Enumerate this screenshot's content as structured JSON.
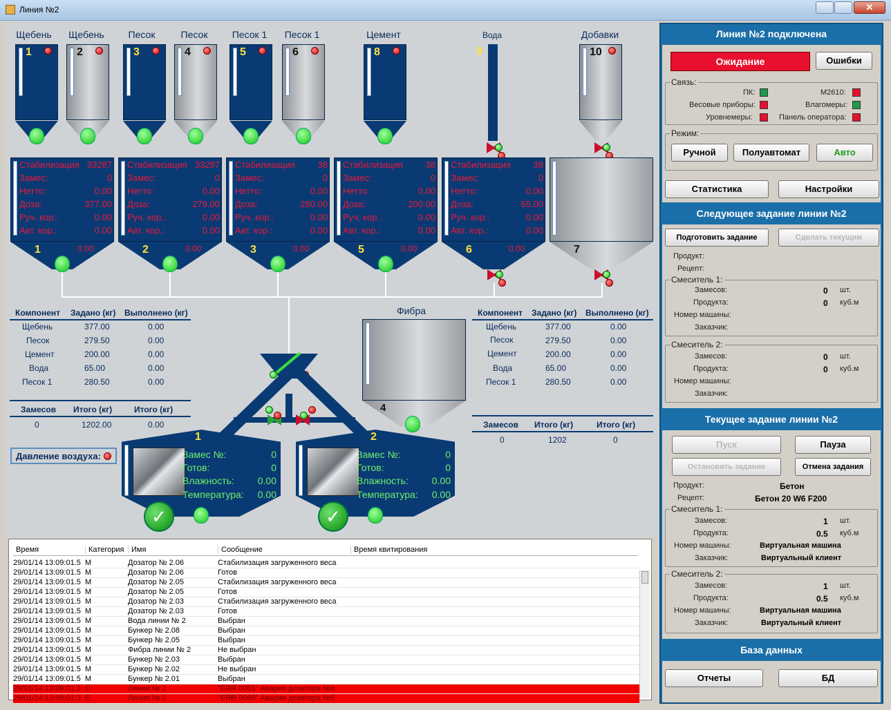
{
  "window": {
    "title": "Линия №2"
  },
  "silos": [
    {
      "label": "Щебень",
      "num": "1"
    },
    {
      "label": "Щебень",
      "num": "2"
    },
    {
      "label": "Песок",
      "num": "3"
    },
    {
      "label": "Песок",
      "num": "4"
    },
    {
      "label": "Песок 1",
      "num": "5"
    },
    {
      "label": "Песок 1",
      "num": "6"
    },
    {
      "label": "Цемент",
      "num": "8"
    },
    {
      "label": "Вода",
      "num": "9"
    },
    {
      "label": "Добавки",
      "num": "10"
    }
  ],
  "hoppers": [
    {
      "num": "1",
      "stab": "33287",
      "zames": "0",
      "netto": "0.00",
      "doza": "377.00",
      "ruch": "0.00",
      "avt": "0.00",
      "val": "0.00"
    },
    {
      "num": "2",
      "stab": "33287",
      "zames": "0",
      "netto": "0.00",
      "doza": "279.00",
      "ruch": "0.00",
      "avt": "0.00",
      "val": "0.00"
    },
    {
      "num": "3",
      "stab": "38",
      "zames": "0",
      "netto": "0.00",
      "doza": "280.00",
      "ruch": "0.00",
      "avt": "0.00",
      "val": "0.00"
    },
    {
      "num": "5",
      "stab": "38",
      "zames": "0",
      "netto": "0.00",
      "doza": "200.00",
      "ruch": "0.00",
      "avt": "0.00",
      "val": "0.00"
    },
    {
      "num": "6",
      "stab": "38",
      "zames": "0",
      "netto": "0.00",
      "doza": "65.00",
      "ruch": "0.00",
      "avt": "0.00",
      "val": "0.00"
    },
    {
      "num": "7"
    }
  ],
  "hopper_labels": {
    "stab": "Стабилизация",
    "zames": "Замес:",
    "netto": "Нетто:",
    "doza": "Доза:",
    "ruch": "Руч. кор.:",
    "avt": "Авт. кор.:"
  },
  "comp_headers": [
    "Компонент",
    "Задано (кг)",
    "Выполнено (кг)"
  ],
  "left_table": [
    [
      "Щебень",
      "377.00",
      "0.00"
    ],
    [
      "Песок",
      "279.50",
      "0.00"
    ],
    [
      "Цемент",
      "200.00",
      "0.00"
    ],
    [
      "Вода",
      "65.00",
      "0.00"
    ],
    [
      "Песок 1",
      "280.50",
      "0.00"
    ]
  ],
  "right_table": [
    [
      "Щебень",
      "377.00",
      "0.00"
    ],
    [
      "Песок",
      "279.50",
      "0.00"
    ],
    [
      "Цемент",
      "200.00",
      "0.00"
    ],
    [
      "Вода",
      "65.00",
      "0.00"
    ],
    [
      "Песок 1",
      "280.50",
      "0.00"
    ]
  ],
  "total_headers": [
    "Замесов",
    "Итого (кг)",
    "Итого (кг)"
  ],
  "left_totals": [
    "0",
    "1202.00",
    "0.00"
  ],
  "right_totals": [
    "0",
    "1202",
    "0"
  ],
  "fibra": {
    "label": "Фибра",
    "num": "4"
  },
  "air_pressure": "Давление воздуха:",
  "mixers": [
    {
      "num": "1",
      "zames_l": "Замес №:",
      "zames": "0",
      "gotov_l": "Готов:",
      "gotov": "0",
      "vlazh_l": "Влажность:",
      "vlazh": "0.00",
      "temp_l": "Температура:",
      "temp": "0.00"
    },
    {
      "num": "2",
      "zames_l": "Замес №:",
      "zames": "0",
      "gotov_l": "Готов:",
      "gotov": "0",
      "vlazh_l": "Влажность:",
      "vlazh": "0.00",
      "temp_l": "Температура:",
      "temp": "0.00"
    }
  ],
  "log": {
    "headers": [
      "Время",
      "Категория",
      "Имя",
      "Сообщение",
      "Время квитирования"
    ],
    "rows": [
      {
        "time": "29/01/14 13:09:01.5",
        "cat": "M",
        "name": "Дозатор № 2.06",
        "msg": "Стабилизация загруженного веса"
      },
      {
        "time": "29/01/14 13:09:01.5",
        "cat": "M",
        "name": "Дозатор № 2.06",
        "msg": "Готов"
      },
      {
        "time": "29/01/14 13:09:01.5",
        "cat": "M",
        "name": "Дозатор № 2.05",
        "msg": "Стабилизация загруженного веса"
      },
      {
        "time": "29/01/14 13:09:01.5",
        "cat": "M",
        "name": "Дозатор № 2.05",
        "msg": "Готов"
      },
      {
        "time": "29/01/14 13:09:01.5",
        "cat": "M",
        "name": "Дозатор № 2.03",
        "msg": "Стабилизация загруженного веса"
      },
      {
        "time": "29/01/14 13:09:01.5",
        "cat": "M",
        "name": "Дозатор № 2.03",
        "msg": "Готов"
      },
      {
        "time": "29/01/14 13:09:01.5",
        "cat": "M",
        "name": "Вода линии № 2",
        "msg": "Выбран"
      },
      {
        "time": "29/01/14 13:09:01.5",
        "cat": "M",
        "name": "Бункер № 2.08",
        "msg": "Выбран"
      },
      {
        "time": "29/01/14 13:09:01.5",
        "cat": "M",
        "name": "Бункер № 2.05",
        "msg": "Выбран"
      },
      {
        "time": "29/01/14 13:09:01.5",
        "cat": "M",
        "name": "Фибра линии № 2",
        "msg": "Не выбран"
      },
      {
        "time": "29/01/14 13:09:01.5",
        "cat": "M",
        "name": "Бункер № 2.03",
        "msg": "Выбран"
      },
      {
        "time": "29/01/14 13:09:01.5",
        "cat": "M",
        "name": "Бункер № 2.02",
        "msg": "Не выбран"
      },
      {
        "time": "29/01/14 13:09:01.5",
        "cat": "M",
        "name": "Бункер № 2.01",
        "msg": "Выбран"
      },
      {
        "time": "29/01/14 13:09:01.3",
        "cat": "E",
        "name": "Линия № 2",
        "msg": "\"ERR 0061\" Авария дозатора №6"
      },
      {
        "time": "29/01/14 13:09:01.3",
        "cat": "E",
        "name": "Линия № 2",
        "msg": "\"ERR 0060\" Авария дозатора №5"
      }
    ]
  },
  "panel": {
    "title": "Линия №2 подключена",
    "status": "Ожидание",
    "errors_btn": "Ошибки",
    "svyaz_label": "Связь:",
    "svyaz": [
      {
        "label": "ПК:",
        "color": "#1f9a4a"
      },
      {
        "label": "М2610:",
        "color": "#e8102e"
      },
      {
        "label": "Весовые приборы:",
        "color": "#e8102e"
      },
      {
        "label": "Влагомеры:",
        "color": "#1f9a4a"
      },
      {
        "label": "Уровнемеры:",
        "color": "#e8102e"
      },
      {
        "label": "Панель оператора:",
        "color": "#e8102e"
      }
    ],
    "mode_label": "Режим:",
    "mode_buttons": [
      "Ручной",
      "Полуавтомат",
      "Авто"
    ],
    "stats_btn": "Статистика",
    "settings_btn": "Настройки",
    "next_title": "Следующее задание линии №2",
    "prepare_btn": "Подготовить задание",
    "make_current_btn": "Сделать текущим",
    "product_l": "Продукт:",
    "recipe_l": "Рецепт:",
    "mixer1_l": "Смеситель 1:",
    "mixer2_l": "Смеситель 2:",
    "zames_l": "Замесов:",
    "produkta_l": "Продукта:",
    "machine_l": "Номер машины:",
    "customer_l": "Заказчик:",
    "unit_pcs": "шт.",
    "unit_m3": "куб.м",
    "next": {
      "m1_zames": "0",
      "m1_prod": "0",
      "m2_zames": "0",
      "m2_prod": "0"
    },
    "current_title": "Текущее задание линии №2",
    "start_btn": "Пуск",
    "pause_btn": "Пауза",
    "stop_btn": "Остановить задание",
    "cancel_btn": "Отмена задания",
    "current": {
      "product": "Бетон",
      "recipe": "Бетон 20 W6 F200",
      "m1_zames": "1",
      "m1_prod": "0.5",
      "m1_machine": "Виртуальная машина",
      "m1_customer": "Виртуальный клиент",
      "m2_zames": "1",
      "m2_prod": "0.5",
      "m2_machine": "Виртуальная машина",
      "m2_customer": "Виртуальный клиент"
    },
    "db_title": "База данных",
    "reports_btn": "Отчеты",
    "db_btn": "БД"
  }
}
